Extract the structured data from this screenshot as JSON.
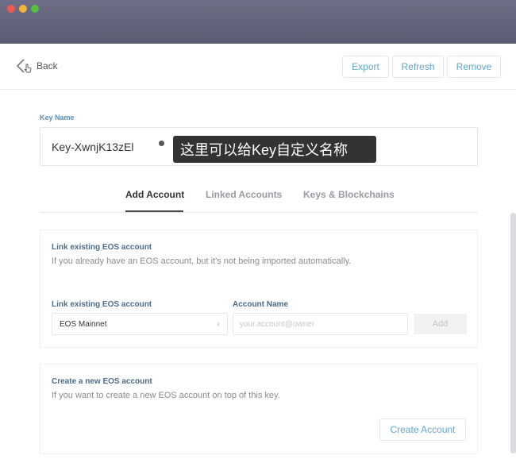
{
  "header": {
    "back_label": "Back",
    "export_label": "Export",
    "refresh_label": "Refresh",
    "remove_label": "Remove"
  },
  "key": {
    "label": "Key Name",
    "value": "Key-XwnjK13zEl"
  },
  "annotation": {
    "text": "这里可以给Key自定义名称"
  },
  "tabs": [
    {
      "label": "Add Account",
      "active": true
    },
    {
      "label": "Linked Accounts",
      "active": false
    },
    {
      "label": "Keys & Blockchains",
      "active": false
    }
  ],
  "link_panel": {
    "title": "Link existing EOS account",
    "description": "If you already have an EOS account, but it's not being imported automatically.",
    "network_label": "Link existing EOS account",
    "network_value": "EOS Mainnet",
    "account_label": "Account Name",
    "account_placeholder": "your.account@owner",
    "add_label": "Add"
  },
  "create_panel": {
    "title": "Create a new EOS account",
    "description": "If you want to create a new EOS account on top of this key.",
    "button_label": "Create Account"
  },
  "colors": {
    "titlebar": "#5f6078",
    "accent": "#5fa8d3",
    "label_blue": "#4b6c8a"
  }
}
